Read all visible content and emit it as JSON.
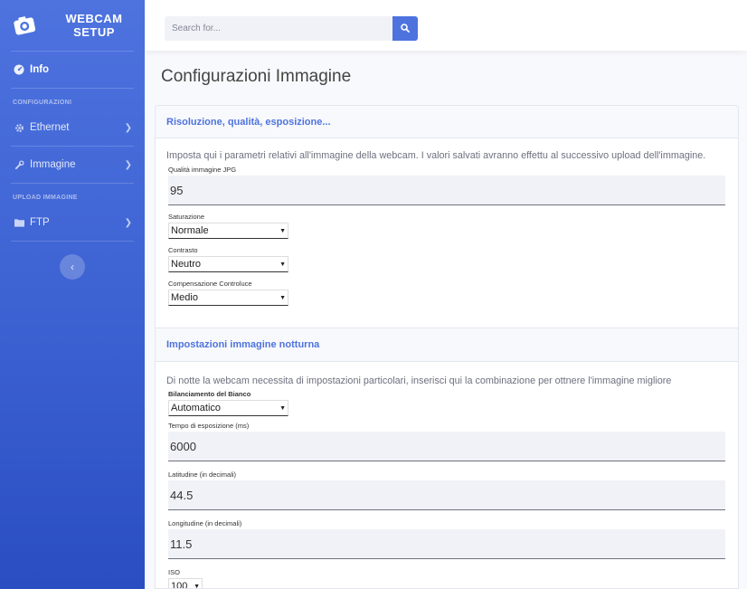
{
  "brand": {
    "line1": "WEBCAM",
    "line2": "SETUP"
  },
  "sidebar": {
    "info": "Info",
    "section_config": "CONFIGURAZIONI",
    "ethernet": "Ethernet",
    "immagine": "Immagine",
    "section_upload": "UPLOAD IMMAGINE",
    "ftp": "FTP",
    "toggle": "‹"
  },
  "search": {
    "placeholder": "Search for..."
  },
  "page": {
    "title": "Configurazioni Immagine"
  },
  "section1": {
    "header": "Risoluzione, qualità, esposizione...",
    "description": "Imposta qui i parametri relativi all'immagine della webcam. I valori salvati avranno effettu al successivo upload dell'immagine.",
    "quality_label": "Qualità immagine JPG",
    "quality_value": "95",
    "saturation_label": "Saturazione",
    "saturation_value": "Normale",
    "contrast_label": "Contrasto",
    "contrast_value": "Neutro",
    "backlight_label": "Compensazione Controluce",
    "backlight_value": "Medio"
  },
  "section2": {
    "header": "Impostazioni immagine notturna",
    "description": "Di notte la webcam necessita di impostazioni particolari, inserisci qui la combinazione per ottnere l'immagine migliore",
    "wb_label": "Bilanciamento del Bianco",
    "wb_value": "Automatico",
    "exposure_label": "Tempo di esposizione (ms)",
    "exposure_value": "6000",
    "latitude_label": "Latitudine (in decimali)",
    "latitude_value": "44.5",
    "longitude_label": "Longitudine (in decimali)",
    "longitude_value": "11.5",
    "iso_label": "ISO",
    "iso_value": "100"
  },
  "colors": {
    "primary": "#4e73df",
    "input_bg": "#f1f2f7"
  }
}
